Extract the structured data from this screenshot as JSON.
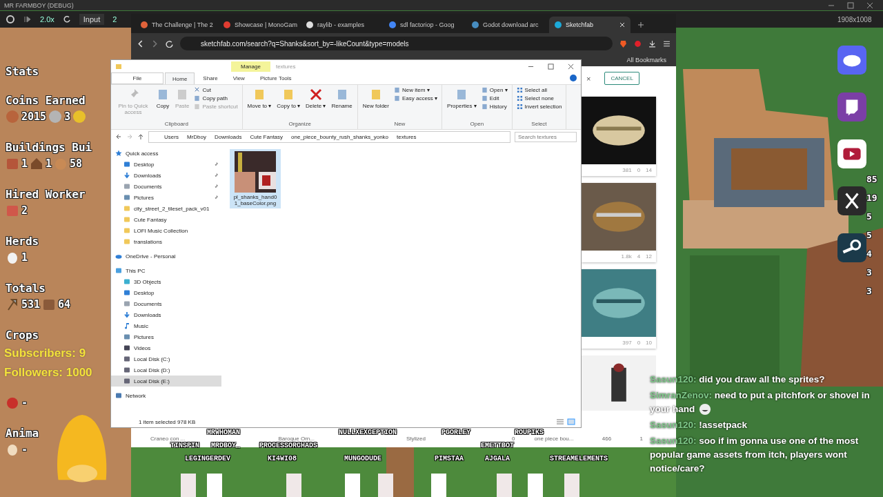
{
  "app_title": "MR FARMBOY (DEBUG)",
  "game_toolbar": {
    "speed": "2.0x",
    "input_label": "Input",
    "counter": "2",
    "resolution": "1908x1008"
  },
  "stats": {
    "title": "Stats",
    "sections": [
      {
        "heading": "Coins Earned",
        "items": [
          {
            "kind": "coin",
            "color": "#b8643c",
            "text": "2015"
          },
          {
            "kind": "coin",
            "color": "#b4b4b4",
            "text": "3"
          },
          {
            "kind": "coin",
            "color": "#e8c02a"
          }
        ]
      },
      {
        "heading": "Buildings Bui",
        "items": [
          {
            "kind": "chest",
            "text": "1"
          },
          {
            "kind": "house",
            "text": "1"
          },
          {
            "kind": "rock",
            "text": "58"
          }
        ]
      },
      {
        "heading": "Hired Worker",
        "items": [
          {
            "kind": "worker",
            "text": "2"
          }
        ]
      },
      {
        "heading": "Herds",
        "items": [
          {
            "kind": "chicken",
            "text": "1"
          }
        ]
      },
      {
        "heading": "Totals",
        "items": [
          {
            "kind": "axe",
            "text": "531"
          },
          {
            "kind": "bag",
            "text": "64"
          }
        ]
      },
      {
        "heading": "Crops",
        "items": [
          {
            "kind": "tomato",
            "text": "-"
          }
        ]
      },
      {
        "heading": "Anima",
        "items": [
          {
            "kind": "egg",
            "text": "-"
          }
        ]
      }
    ]
  },
  "stream_counts": {
    "subscribers": "Subscribers: 9",
    "followers": "Followers: 1000"
  },
  "side_counts": [
    "85",
    "19",
    "5",
    "5",
    "4",
    "3",
    "3"
  ],
  "browser": {
    "tabs": [
      {
        "label": "The Challenge | The 2",
        "color": "#e0623a",
        "selected": false
      },
      {
        "label": "Showcase | MonoGam",
        "color": "#e03c31",
        "selected": false
      },
      {
        "label": "raylib - examples",
        "color": "#dddddd",
        "selected": false
      },
      {
        "label": "sdl factoriop - Goog",
        "color": "#4285f4",
        "selected": false
      },
      {
        "label": "Godot download arc",
        "color": "#478cbf",
        "selected": false
      },
      {
        "label": "Sketchfab",
        "color": "#1caad9",
        "selected": true
      }
    ],
    "address": "sketchfab.com/search?q=Shanks&sort_by=-likeCount&type=models",
    "bookmarks_label": "All Bookmarks",
    "page": {
      "cancel": "CANCEL",
      "clear": "×",
      "side_cards": [
        {
          "views": "381",
          "comments": "0",
          "likes": "14"
        },
        {
          "views": "1.8k",
          "comments": "4",
          "likes": "12"
        },
        {
          "views": "397",
          "comments": "0",
          "likes": "10"
        },
        {
          "kind": "picture"
        }
      ],
      "bottom_cards": [
        {
          "title": "Craneo con ..."
        },
        {
          "title": "Baroque Orn..."
        },
        {
          "title": "Stylized",
          "comments": "0"
        },
        {
          "title": "one piece bou...",
          "views": "466",
          "comments": "1"
        }
      ]
    }
  },
  "explorer": {
    "title": "textures",
    "context_tab": "Manage",
    "ribbon_tabs": [
      {
        "label": "File",
        "kind": "file",
        "selected": false
      },
      {
        "label": "Home",
        "kind": "tab",
        "selected": true
      },
      {
        "label": "Share",
        "kind": "tab",
        "selected": false
      },
      {
        "label": "View",
        "kind": "tab",
        "selected": false
      },
      {
        "label": "Picture Tools",
        "kind": "tab",
        "selected": false
      }
    ],
    "groups": [
      {
        "name": "Clipboard",
        "large": [
          {
            "label": "Pin to Quick access",
            "kind": "pin",
            "disabled": true
          },
          {
            "label": "Copy",
            "kind": "copy",
            "disabled": false
          },
          {
            "label": "Paste",
            "kind": "paste",
            "disabled": true
          }
        ],
        "small": [
          {
            "label": "Cut",
            "kind": "cut",
            "disabled": false
          },
          {
            "label": "Copy path",
            "kind": "path",
            "disabled": false
          },
          {
            "label": "Paste shortcut",
            "kind": "shortcut",
            "disabled": true
          }
        ]
      },
      {
        "name": "Organize",
        "large": [
          {
            "label": "Move to ▾",
            "kind": "move",
            "disabled": false
          },
          {
            "label": "Copy to ▾",
            "kind": "copyto",
            "disabled": false
          },
          {
            "label": "Delete ▾",
            "kind": "delete",
            "disabled": false
          },
          {
            "label": "Rename",
            "kind": "rename",
            "disabled": false
          }
        ]
      },
      {
        "name": "New",
        "large": [
          {
            "label": "New folder",
            "kind": "folder",
            "disabled": false
          }
        ],
        "small": [
          {
            "label": "New item ▾",
            "kind": "newitem",
            "disabled": false
          },
          {
            "label": "Easy access ▾",
            "kind": "easy",
            "disabled": false
          }
        ]
      },
      {
        "name": "Open",
        "large": [
          {
            "label": "Properties ▾",
            "kind": "properties",
            "disabled": false
          }
        ],
        "small": [
          {
            "label": "Open ▾",
            "kind": "open",
            "disabled": false
          },
          {
            "label": "Edit",
            "kind": "edit",
            "disabled": false
          },
          {
            "label": "History",
            "kind": "history",
            "disabled": false
          }
        ]
      },
      {
        "name": "Select",
        "small": [
          {
            "label": "Select all",
            "kind": "selectall",
            "disabled": false
          },
          {
            "label": "Select none",
            "kind": "selectnone",
            "disabled": false
          },
          {
            "label": "Invert selection",
            "kind": "invert",
            "disabled": false
          }
        ]
      }
    ],
    "path": [
      "Users",
      "MrDboy",
      "Downloads",
      "Cute Fantasy",
      "one_piece_bounty_rush_shanks_yonko",
      "textures"
    ],
    "search_placeholder": "Search textures",
    "nav": [
      {
        "label": "Quick access",
        "kind": "star",
        "selected": false,
        "children": [
          {
            "label": "Desktop",
            "kind": "desktop",
            "pinned": true,
            "selected": false
          },
          {
            "label": "Downloads",
            "kind": "download",
            "pinned": true,
            "selected": false
          },
          {
            "label": "Documents",
            "kind": "document",
            "pinned": true,
            "selected": false
          },
          {
            "label": "Pictures",
            "kind": "pictures",
            "pinned": true,
            "selected": false
          },
          {
            "label": "city_street_2_tileset_pack_v01",
            "kind": "folder",
            "pinned": false,
            "selected": false
          },
          {
            "label": "Cute Fantasy",
            "kind": "folder",
            "pinned": false,
            "selected": false
          },
          {
            "label": "LOFI Music Collection",
            "kind": "folder",
            "pinned": false,
            "selected": false
          },
          {
            "label": "translations",
            "kind": "folder",
            "pinned": false,
            "selected": false
          }
        ]
      },
      {
        "label": "OneDrive - Personal",
        "kind": "cloud",
        "selected": false
      },
      {
        "label": "This PC",
        "kind": "pc",
        "selected": false,
        "children": [
          {
            "label": "3D Objects",
            "kind": "cube",
            "selected": false
          },
          {
            "label": "Desktop",
            "kind": "desktop",
            "selected": false
          },
          {
            "label": "Documents",
            "kind": "document",
            "selected": false
          },
          {
            "label": "Downloads",
            "kind": "download",
            "selected": false
          },
          {
            "label": "Music",
            "kind": "music",
            "selected": false
          },
          {
            "label": "Pictures",
            "kind": "pictures",
            "selected": false
          },
          {
            "label": "Videos",
            "kind": "video",
            "selected": false
          },
          {
            "label": "Local Disk (C:)",
            "kind": "drive",
            "selected": false
          },
          {
            "label": "Local Disk (D:)",
            "kind": "drive",
            "selected": false
          },
          {
            "label": "Local Disk (E:)",
            "kind": "drive",
            "selected": true
          }
        ]
      },
      {
        "label": "Network",
        "kind": "network",
        "selected": false
      }
    ],
    "files": [
      {
        "name": "pl_shanks_hand01_baseColor.png",
        "selected": true
      }
    ],
    "status": "1 item selected  978 KB"
  },
  "viewer_names": [
    "MRWHOMAN",
    "NULLXEXCEPTION",
    "PGORLEY",
    "ROUPIKS",
    "TINSPIN",
    "MRDBOY_",
    "PROCESSORCHADS",
    "EMETTBOT",
    "LEGINGERDEV",
    "KI4WI08",
    "MUNGODUDE",
    "PIMSTAA",
    "AJGALA",
    "STREAMELEMENTS"
  ],
  "chat": [
    {
      "user": "Sasun120:",
      "text": "did you draw all the sprites?"
    },
    {
      "user": "SimranZenov:",
      "text": "need to put a pitchfork or shovel in your hand",
      "emote": true
    },
    {
      "user": "Sasun120:",
      "text": "!assetpack"
    },
    {
      "user": "Sasun120:",
      "text": "soo if im gonna use one of the most popular game assets from itch, players wont notice/care?"
    }
  ]
}
